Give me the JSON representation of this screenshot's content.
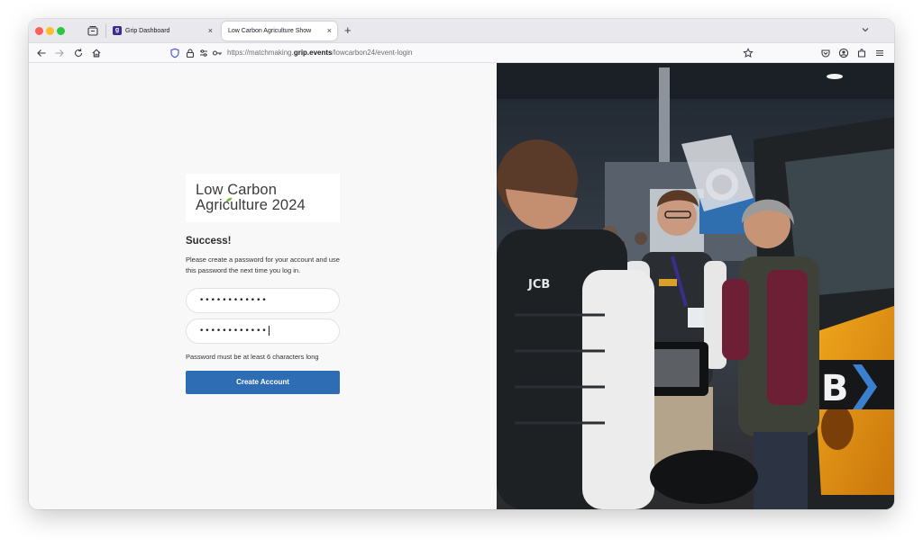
{
  "browser": {
    "tabs": [
      {
        "label": "Grip Dashboard",
        "favicon": "grip-logo-icon",
        "active": false
      },
      {
        "label": "Low Carbon Agriculture Show",
        "active": true
      }
    ],
    "address": {
      "prefix": "https://matchmaking.",
      "domain": "grip.events",
      "path": "/lowcarbon24/event-login"
    },
    "new_tab": "+",
    "close_glyph": "×",
    "favicon_text": "g"
  },
  "logo": {
    "line1": "Low Carbon",
    "line2": "Agriculture 2024",
    "accent_color": "#7ab648"
  },
  "form": {
    "heading": "Success!",
    "description": "Please create a password for your account and use this password the next time you log in.",
    "password_value": "••••••••••••",
    "confirm_value": "••••••••••••",
    "hint": "Password must be at least 6 characters long",
    "submit_label": "Create Account",
    "button_color": "#2e6db4"
  }
}
